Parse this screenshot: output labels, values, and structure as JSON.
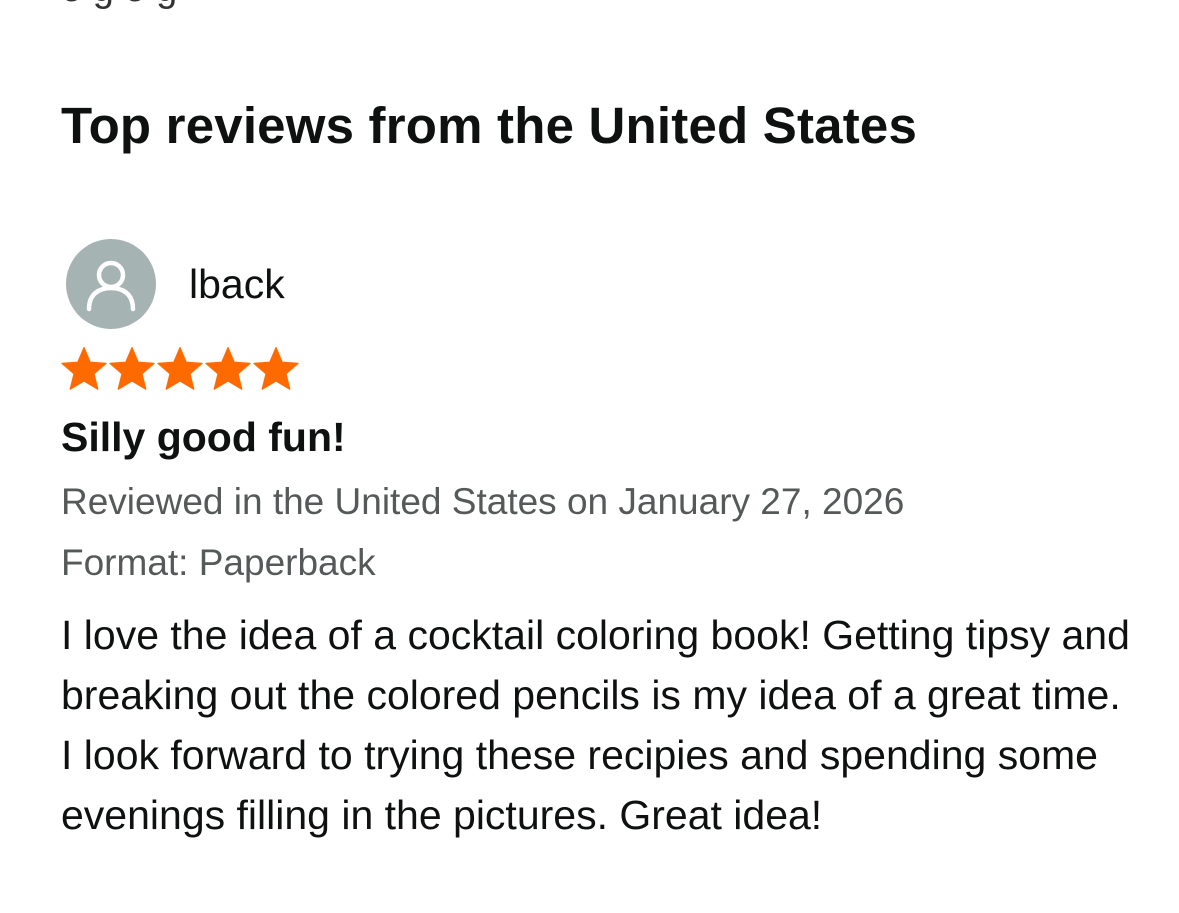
{
  "truncated_top_text": "e  g        e  g",
  "section": {
    "title": "Top reviews from the United States"
  },
  "review": {
    "reviewer": {
      "name": "lback",
      "avatar_icon": "user-silhouette-icon",
      "avatar_color": "#a5b3b3"
    },
    "rating": {
      "value": 5,
      "max": 5,
      "star_icon": "star-icon",
      "star_color": "#ff6a00"
    },
    "title": "Silly good fun!",
    "date_line": "Reviewed in the United States on January 27, 2026",
    "format_line": "Format: Paperback",
    "body": "I love the idea of a cocktail coloring book! Getting tipsy and breaking out the colored pencils is my idea of a great time. I look forward to trying these recipies and spending some evenings filling in the pictures. Great idea!"
  }
}
